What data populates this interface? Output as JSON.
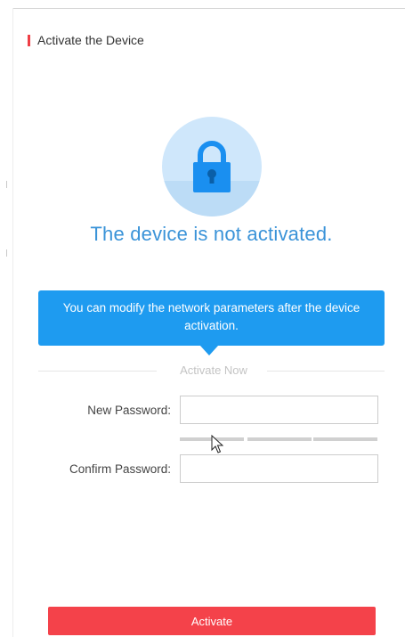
{
  "header": {
    "title": "Activate the Device"
  },
  "status": {
    "message": "The device is not activated.",
    "lock_icon": "lock-icon",
    "color": "#3a93d8"
  },
  "tooltip": {
    "text": "You can modify the network parameters after the device activation.",
    "color": "#1e9bf0"
  },
  "section": {
    "divider_label": "Activate Now"
  },
  "form": {
    "new_password": {
      "label": "New Password:",
      "value": ""
    },
    "password_strength_level": 0,
    "confirm_password": {
      "label": "Confirm Password:",
      "value": ""
    }
  },
  "actions": {
    "activate_label": "Activate",
    "button_color": "#f4424a"
  },
  "accent_color": "#ef3f46"
}
